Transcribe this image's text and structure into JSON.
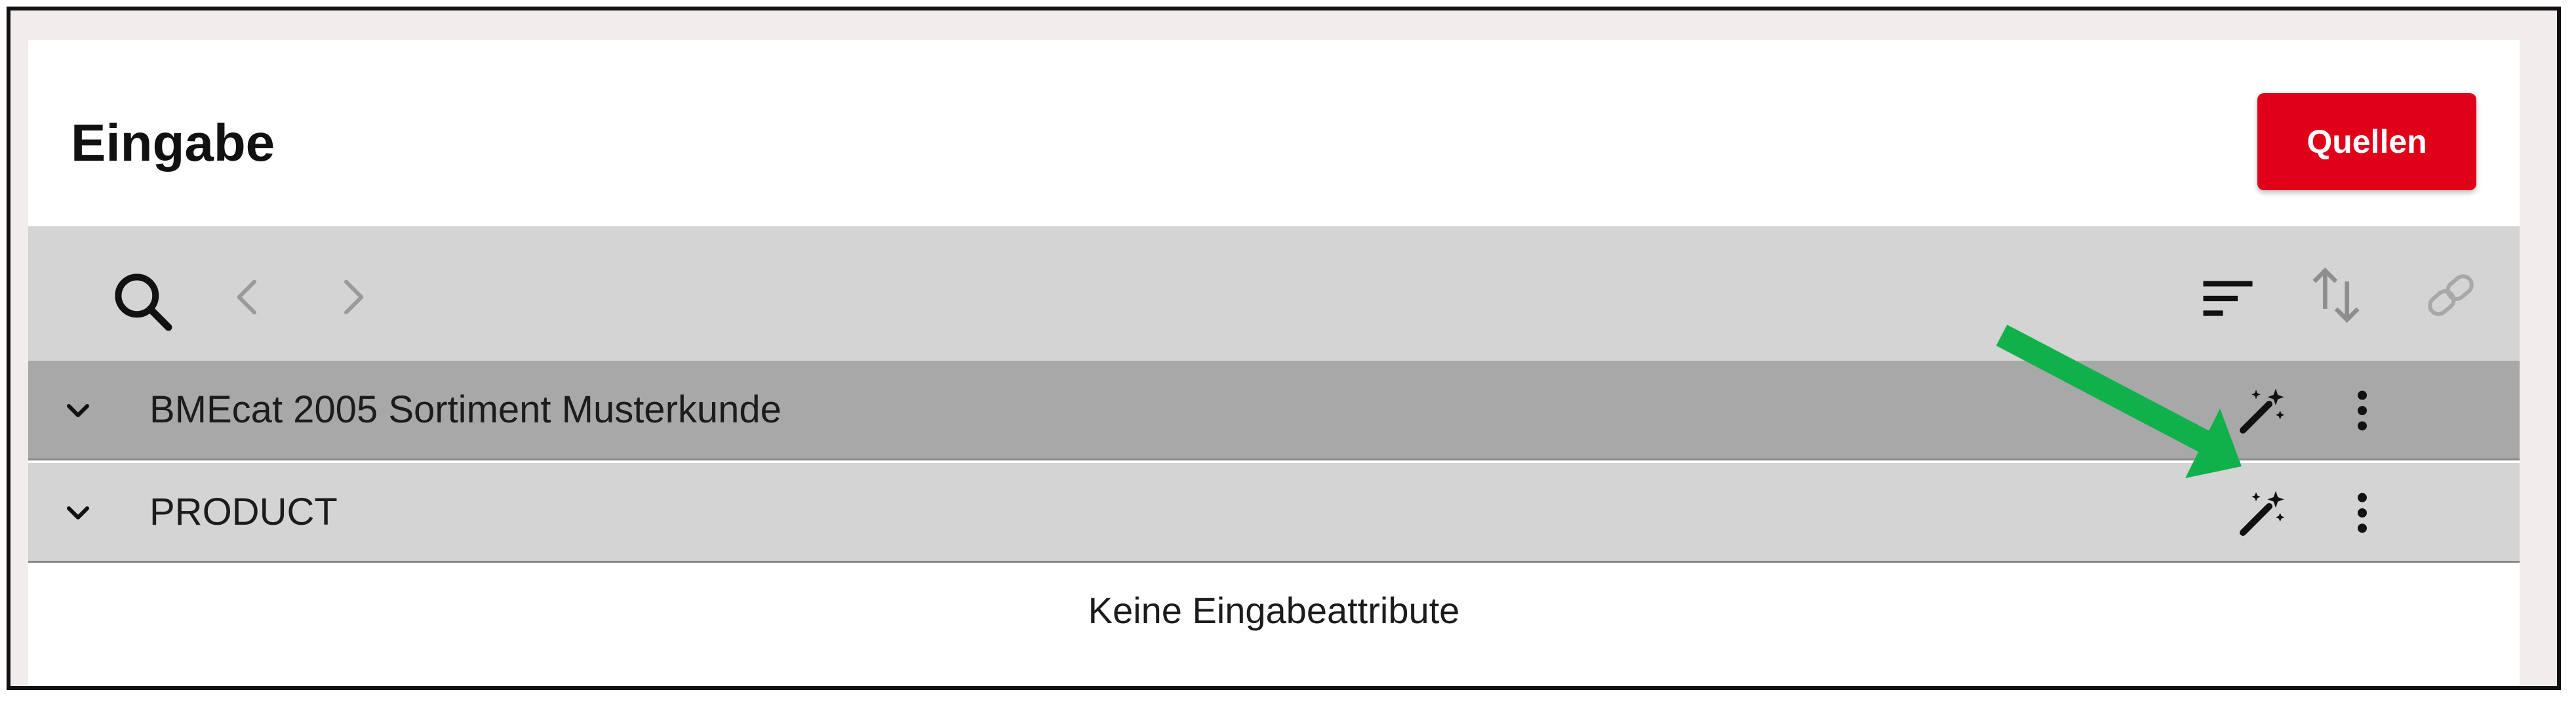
{
  "panel": {
    "title": "Eingabe",
    "sources_button_label": "Quellen"
  },
  "toolbar": {
    "left_icons": [
      "search-icon",
      "chevron-left-icon",
      "chevron-right-icon"
    ],
    "right_icons": [
      "sort-icon",
      "swap-vertical-icon",
      "link-icon"
    ]
  },
  "tree_rows": [
    {
      "label": "BMEcat 2005 Sortiment Musterkunde",
      "expanded": true,
      "highlighted": true
    },
    {
      "label": "PRODUCT",
      "expanded": true,
      "highlighted": false
    }
  ],
  "row_actions": [
    "magic-wand-icon",
    "more-vertical-icon"
  ],
  "empty_message": "Keine Eingabeattribute",
  "colors": {
    "brand_red": "#e1001a",
    "toolbar_gray": "#d4d4d4",
    "selected_row_gray": "#a8a8a8",
    "annotation_arrow_green": "#10b04a"
  }
}
